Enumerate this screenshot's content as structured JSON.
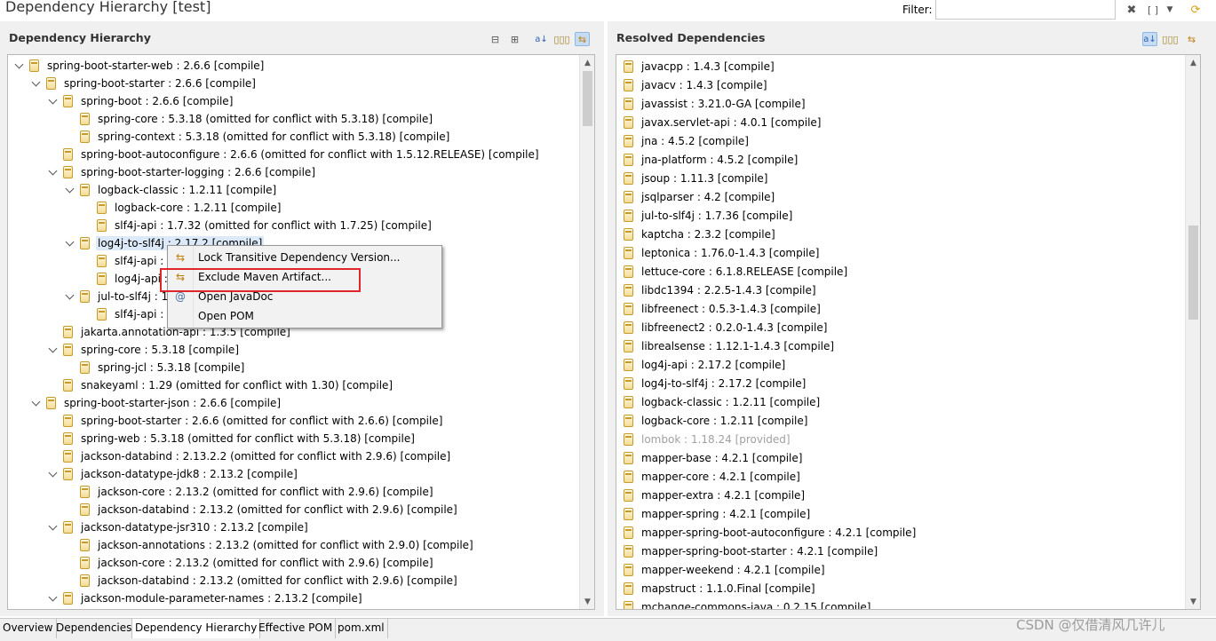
{
  "window": {
    "title": "Dependency Hierarchy [test]",
    "filter_label": "Filter:",
    "filter_value": ""
  },
  "left_panel": {
    "title": "Dependency Hierarchy",
    "toolbar_icons": [
      "collapse-all-icon",
      "expand-all-icon",
      "sort-alphabetical-icon",
      "show-group-id-icon",
      "show-conflicts-icon"
    ],
    "tree": [
      {
        "label": "spring-boot-starter-web : 2.6.6 [compile]",
        "depth": 0,
        "expanded": true
      },
      {
        "label": "spring-boot-starter : 2.6.6 [compile]",
        "depth": 1,
        "expanded": true
      },
      {
        "label": "spring-boot : 2.6.6 [compile]",
        "depth": 2,
        "expanded": true
      },
      {
        "label": "spring-core : 5.3.18 (omitted for conflict with 5.3.18) [compile]",
        "depth": 3,
        "expanded": null
      },
      {
        "label": "spring-context : 5.3.18 (omitted for conflict with 5.3.18) [compile]",
        "depth": 3,
        "expanded": null
      },
      {
        "label": "spring-boot-autoconfigure : 2.6.6 (omitted for conflict with 1.5.12.RELEASE) [compile]",
        "depth": 2,
        "expanded": null
      },
      {
        "label": "spring-boot-starter-logging : 2.6.6 [compile]",
        "depth": 2,
        "expanded": true
      },
      {
        "label": "logback-classic : 1.2.11 [compile]",
        "depth": 3,
        "expanded": true
      },
      {
        "label": "logback-core : 1.2.11 [compile]",
        "depth": 4,
        "expanded": null
      },
      {
        "label": "slf4j-api : 1.7.32 (omitted for conflict with 1.7.25) [compile]",
        "depth": 4,
        "expanded": null
      },
      {
        "label": "log4j-to-slf4j : 2.17.2 [compile]",
        "depth": 3,
        "expanded": true,
        "selected": true
      },
      {
        "label": "slf4j-api : 1.7.32 (omitted for conflict with 1.7.25) [compile]",
        "depth": 4,
        "expanded": null
      },
      {
        "label": "log4j-api : 2.17.2 [compile]",
        "depth": 4,
        "expanded": null
      },
      {
        "label": "jul-to-slf4j : 1.7.36 [compile]",
        "depth": 3,
        "expanded": true
      },
      {
        "label": "slf4j-api : 1.7.32 (omitted for conflict with 1.7.25) [compile]",
        "depth": 4,
        "expanded": null
      },
      {
        "label": "jakarta.annotation-api : 1.3.5 [compile]",
        "depth": 2,
        "expanded": null
      },
      {
        "label": "spring-core : 5.3.18 [compile]",
        "depth": 2,
        "expanded": true
      },
      {
        "label": "spring-jcl : 5.3.18 [compile]",
        "depth": 3,
        "expanded": null
      },
      {
        "label": "snakeyaml : 1.29 (omitted for conflict with 1.30) [compile]",
        "depth": 2,
        "expanded": null
      },
      {
        "label": "spring-boot-starter-json : 2.6.6 [compile]",
        "depth": 1,
        "expanded": true
      },
      {
        "label": "spring-boot-starter : 2.6.6 (omitted for conflict with 2.6.6) [compile]",
        "depth": 2,
        "expanded": null
      },
      {
        "label": "spring-web : 5.3.18 (omitted for conflict with 5.3.18) [compile]",
        "depth": 2,
        "expanded": null
      },
      {
        "label": "jackson-databind : 2.13.2.2 (omitted for conflict with 2.9.6) [compile]",
        "depth": 2,
        "expanded": null
      },
      {
        "label": "jackson-datatype-jdk8 : 2.13.2 [compile]",
        "depth": 2,
        "expanded": true
      },
      {
        "label": "jackson-core : 2.13.2 (omitted for conflict with 2.9.6) [compile]",
        "depth": 3,
        "expanded": null
      },
      {
        "label": "jackson-databind : 2.13.2 (omitted for conflict with 2.9.6) [compile]",
        "depth": 3,
        "expanded": null
      },
      {
        "label": "jackson-datatype-jsr310 : 2.13.2 [compile]",
        "depth": 2,
        "expanded": true
      },
      {
        "label": "jackson-annotations : 2.13.2 (omitted for conflict with 2.9.0) [compile]",
        "depth": 3,
        "expanded": null
      },
      {
        "label": "jackson-core : 2.13.2 (omitted for conflict with 2.9.6) [compile]",
        "depth": 3,
        "expanded": null
      },
      {
        "label": "jackson-databind : 2.13.2 (omitted for conflict with 2.9.6) [compile]",
        "depth": 3,
        "expanded": null
      },
      {
        "label": "jackson-module-parameter-names : 2.13.2 [compile]",
        "depth": 2,
        "expanded": true
      }
    ]
  },
  "right_panel": {
    "title": "Resolved Dependencies",
    "toolbar_icons": [
      "sort-alphabetical-icon",
      "show-group-id-icon",
      "show-conflicts-icon"
    ],
    "items": [
      {
        "label": "javacpp : 1.4.3 [compile]",
        "gray": false
      },
      {
        "label": "javacv : 1.4.3 [compile]",
        "gray": false
      },
      {
        "label": "javassist : 3.21.0-GA [compile]",
        "gray": false
      },
      {
        "label": "javax.servlet-api : 4.0.1 [compile]",
        "gray": false
      },
      {
        "label": "jna : 4.5.2 [compile]",
        "gray": false
      },
      {
        "label": "jna-platform : 4.5.2 [compile]",
        "gray": false
      },
      {
        "label": "jsoup : 1.11.3 [compile]",
        "gray": false
      },
      {
        "label": "jsqlparser : 4.2 [compile]",
        "gray": false
      },
      {
        "label": "jul-to-slf4j : 1.7.36 [compile]",
        "gray": false
      },
      {
        "label": "kaptcha : 2.3.2 [compile]",
        "gray": false
      },
      {
        "label": "leptonica : 1.76.0-1.4.3 [compile]",
        "gray": false
      },
      {
        "label": "lettuce-core : 6.1.8.RELEASE [compile]",
        "gray": false
      },
      {
        "label": "libdc1394 : 2.2.5-1.4.3 [compile]",
        "gray": false
      },
      {
        "label": "libfreenect : 0.5.3-1.4.3 [compile]",
        "gray": false
      },
      {
        "label": "libfreenect2 : 0.2.0-1.4.3 [compile]",
        "gray": false
      },
      {
        "label": "librealsense : 1.12.1-1.4.3 [compile]",
        "gray": false
      },
      {
        "label": "log4j-api : 2.17.2 [compile]",
        "gray": false
      },
      {
        "label": "log4j-to-slf4j : 2.17.2 [compile]",
        "gray": false
      },
      {
        "label": "logback-classic : 1.2.11 [compile]",
        "gray": false
      },
      {
        "label": "logback-core : 1.2.11 [compile]",
        "gray": false
      },
      {
        "label": "lombok : 1.18.24 [provided]",
        "gray": true
      },
      {
        "label": "mapper-base : 4.2.1 [compile]",
        "gray": false
      },
      {
        "label": "mapper-core : 4.2.1 [compile]",
        "gray": false
      },
      {
        "label": "mapper-extra : 4.2.1 [compile]",
        "gray": false
      },
      {
        "label": "mapper-spring : 4.2.1 [compile]",
        "gray": false
      },
      {
        "label": "mapper-spring-boot-autoconfigure : 4.2.1 [compile]",
        "gray": false
      },
      {
        "label": "mapper-spring-boot-starter : 4.2.1 [compile]",
        "gray": false
      },
      {
        "label": "mapper-weekend : 4.2.1 [compile]",
        "gray": false
      },
      {
        "label": "mapstruct : 1.1.0.Final [compile]",
        "gray": false
      },
      {
        "label": "mchange-commons-java : 0.2.15 [compile]",
        "gray": false
      }
    ]
  },
  "context_menu": {
    "items": [
      {
        "label": "Lock Transitive Dependency Version...",
        "icon": "lock-version-icon"
      },
      {
        "label": "Exclude Maven Artifact...",
        "icon": "exclude-artifact-icon",
        "highlighted": true
      },
      {
        "label": "Open JavaDoc",
        "icon": "javadoc-icon"
      },
      {
        "label": "Open POM",
        "icon": ""
      }
    ]
  },
  "editor_tabs": [
    {
      "label": "Overview",
      "active": false
    },
    {
      "label": "Dependencies",
      "active": false
    },
    {
      "label": "Dependency Hierarchy",
      "active": true
    },
    {
      "label": "Effective POM",
      "active": false
    },
    {
      "label": "pom.xml",
      "active": false
    }
  ],
  "watermark": "CSDN @仅借清风几许儿",
  "colors": {
    "selection": "#dbe9f8",
    "highlight_box": "#e0262a",
    "jar_icon": "#c69a2b"
  }
}
